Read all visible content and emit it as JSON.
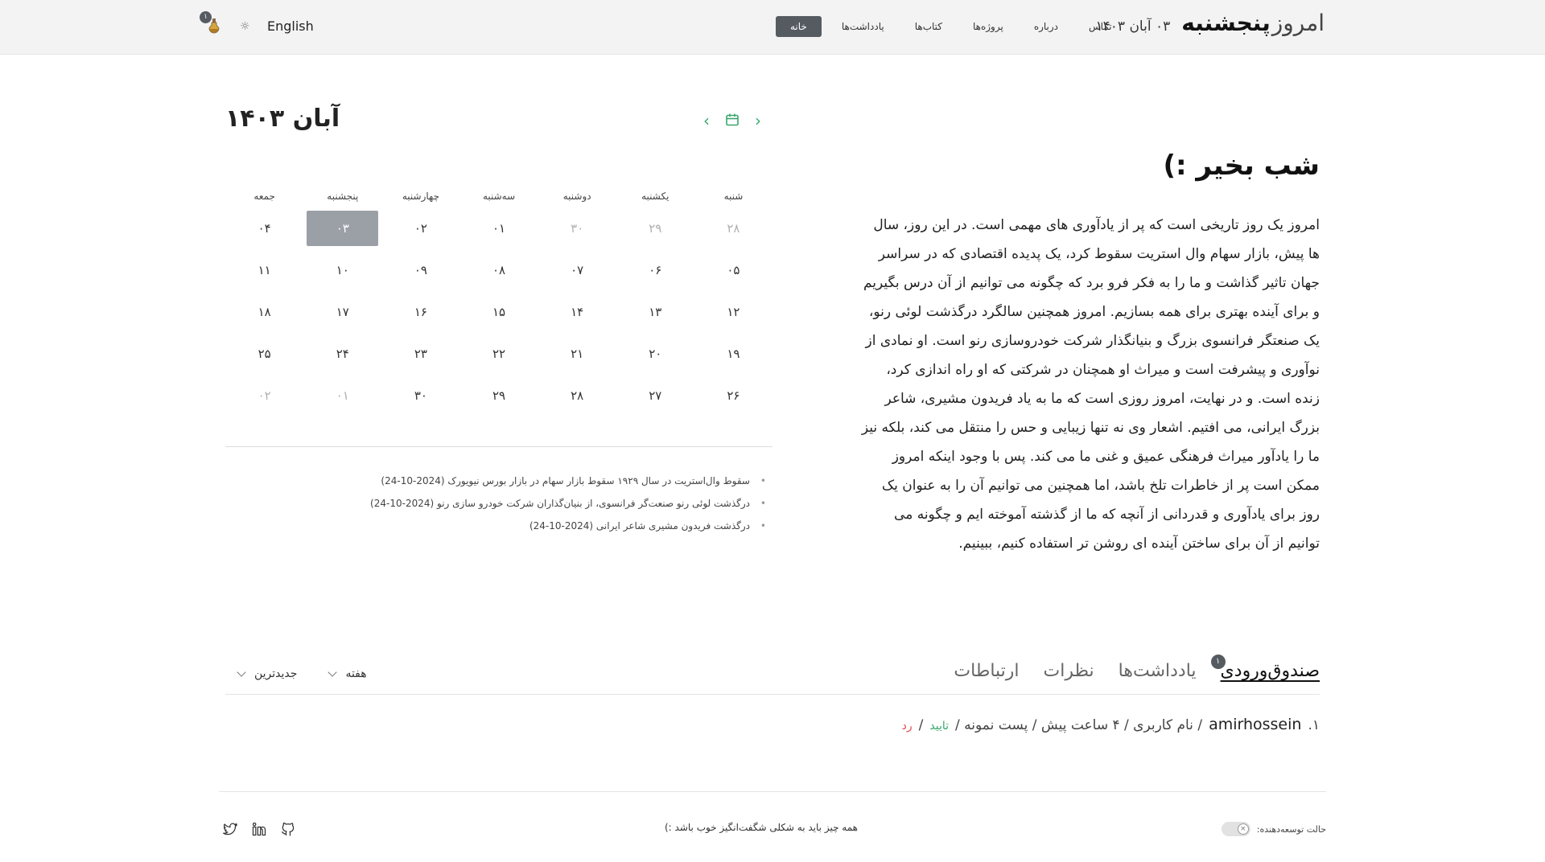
{
  "header": {
    "brand_prefix": "امروز",
    "brand_day": "پنجشنبه",
    "brand_date": "۰۳ آبان ۱۴۰۳",
    "nav": [
      "خانه",
      "یادداشت‌ها",
      "کتاب‌ها",
      "پروژه‌ها",
      "درباره",
      "تماس"
    ],
    "active_nav": "خانه",
    "lang_label": "English",
    "potion_badge": "۱"
  },
  "greeting": {
    "title": "شب بخیر :)",
    "body": "امروز یک روز تاریخی است که پر از یادآوری های مهمی است. در این روز، سال ها پیش، بازار سهام وال استریت سقوط کرد، یک پدیده اقتصادی که در سراسر جهان تاثیر گذاشت و ما را به فکر فرو برد که چگونه می توانیم از آن درس بگیریم و برای آینده بهتری برای همه بسازیم. امروز همچنین سالگرد درگذشت لوئی رنو، یک صنعتگر فرانسوی بزرگ و بنیانگذار شرکت خودروسازی رنو است. او نمادی از نوآوری و پیشرفت است و میراث او همچنان در شرکتی که او راه اندازی کرد، زنده است. و در نهایت، امروز روزی است که ما به یاد فریدون مشیری، شاعر بزرگ ایرانی، می افتیم. اشعار وی نه تنها زیبایی و حس را منتقل می کند، بلکه نیز ما را یادآور میراث فرهنگی عمیق و غنی ما می کند. پس با وجود اینکه امروز ممکن است پر از خاطرات تلخ باشد، اما همچنین می توانیم آن را به عنوان یک روز برای یادآوری و قدردانی از آنچه که ما از گذشته آموخته ایم و چگونه می توانیم از آن برای ساختن آینده ای روشن تر استفاده کنیم، ببینیم."
  },
  "calendar": {
    "title": "آبان ۱۴۰۳",
    "weekdays": [
      "شنبه",
      "یکشنبه",
      "دوشنبه",
      "سه‌شنبه",
      "چهارشنبه",
      "پنجشنبه",
      "جمعه"
    ],
    "weeks": [
      [
        {
          "d": "۲۸",
          "m": true
        },
        {
          "d": "۲۹",
          "m": true
        },
        {
          "d": "۳۰",
          "m": true
        },
        {
          "d": "۰۱"
        },
        {
          "d": "۰۲"
        },
        {
          "d": "۰۳",
          "t": true
        },
        {
          "d": "۰۴"
        }
      ],
      [
        {
          "d": "۰۵"
        },
        {
          "d": "۰۶"
        },
        {
          "d": "۰۷"
        },
        {
          "d": "۰۸"
        },
        {
          "d": "۰۹"
        },
        {
          "d": "۱۰"
        },
        {
          "d": "۱۱"
        }
      ],
      [
        {
          "d": "۱۲"
        },
        {
          "d": "۱۳"
        },
        {
          "d": "۱۴"
        },
        {
          "d": "۱۵"
        },
        {
          "d": "۱۶"
        },
        {
          "d": "۱۷"
        },
        {
          "d": "۱۸"
        }
      ],
      [
        {
          "d": "۱۹"
        },
        {
          "d": "۲۰"
        },
        {
          "d": "۲۱"
        },
        {
          "d": "۲۲"
        },
        {
          "d": "۲۳"
        },
        {
          "d": "۲۴"
        },
        {
          "d": "۲۵"
        }
      ],
      [
        {
          "d": "۲۶"
        },
        {
          "d": "۲۷"
        },
        {
          "d": "۲۸"
        },
        {
          "d": "۲۹"
        },
        {
          "d": "۳۰"
        },
        {
          "d": "۰۱",
          "m": true
        },
        {
          "d": "۰۲",
          "m": true
        }
      ]
    ],
    "events": [
      "سقوط وال‌استریت در سال ۱۹۲۹ سقوط بازار سهام در بازار بورس نیویورک (2024-10-24)",
      "درگذشت لوئی رنو صنعت‌گر فرانسوی، از بنیان‌گذاران شرکت خودرو سازی رنو (2024-10-24)",
      "درگذشت فریدون مشیری شاعر ایرانی (2024-10-24)"
    ]
  },
  "tabs": {
    "items": [
      "صندوق‌ورودی",
      "یادداشت‌ها",
      "نظرات",
      "ارتباطات"
    ],
    "badge": "۱",
    "filter_period": "هفته",
    "filter_sort": "جدیدترین"
  },
  "inbox": {
    "index": "۱.",
    "user": "amirhossein",
    "meta": "/ نام کاربری / ۴ ساعت پیش / پست نمونه /",
    "approve": "تایید",
    "sep": "/",
    "reject": "رد"
  },
  "footer": {
    "dev_mode": "حالت توسعه‌دهنده:",
    "tagline": "همه چیز باید به شکلی شگفت‌انگیز خوب باشد :)"
  },
  "colors": {
    "accent": "#3aa76d",
    "active": "#555b61",
    "reject": "#d9534f"
  }
}
